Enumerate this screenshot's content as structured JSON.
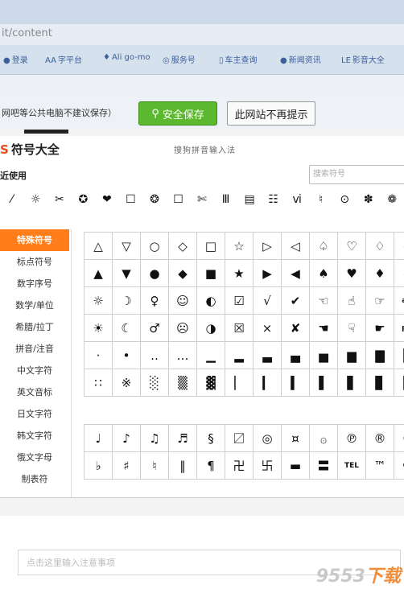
{
  "browser": {
    "address": "it/content",
    "favorites": [
      {
        "icon": "●",
        "label": "登录"
      },
      {
        "icon": "AA",
        "label": "字平台"
      },
      {
        "icon": "♦",
        "label": "Ali go-mo"
      },
      {
        "icon": "◎",
        "label": "服务号"
      },
      {
        "icon": "▯",
        "label": "车主查询"
      },
      {
        "icon": "●",
        "label": "新闻资讯"
      },
      {
        "icon": "LE",
        "label": "影音大全"
      }
    ]
  },
  "save_prompt": {
    "text": "网吧等公共电脑不建议保存）",
    "save_button": "安全保存",
    "no_prompt_button": "此网站不再提示"
  },
  "popup": {
    "title": "符号大全",
    "ime_name": "搜狗拼音输入法",
    "recent_label": "近使用",
    "search_placeholder": "搜索符号",
    "recent_symbols": [
      "⁄",
      "☼",
      "✂",
      "✪",
      "❤",
      "☐",
      "❂",
      "☐",
      "✄",
      "Ⅲ",
      "▤",
      "☷",
      "ⅵ",
      "♮",
      "⊙",
      "✽",
      "❁"
    ],
    "categories": [
      "特殊符号",
      "标点符号",
      "数字序号",
      "数学/单位",
      "希腊/拉丁",
      "拼音/注音",
      "中文字符",
      "英文音标",
      "日文字符",
      "韩文字符",
      "俄文字母",
      "制表符"
    ],
    "active_category": "特殊符号",
    "grid1": [
      [
        "△",
        "▽",
        "○",
        "◇",
        "□",
        "☆",
        "▷",
        "◁",
        "♤",
        "♡",
        "♢",
        "♧"
      ],
      [
        "▲",
        "▼",
        "●",
        "◆",
        "■",
        "★",
        "▶",
        "◀",
        "♠",
        "♥",
        "♦",
        "♣"
      ],
      [
        "☼",
        "☽",
        "♀",
        "☺",
        "◐",
        "☑",
        "√",
        "✔",
        "☜",
        "☝",
        "☞",
        "am"
      ],
      [
        "☀",
        "☾",
        "♂",
        "☹",
        "◑",
        "☒",
        "×",
        "✘",
        "☚",
        "☟",
        "☛",
        "pm"
      ],
      [
        "·",
        "•",
        "‥",
        "…",
        "▁",
        "▂",
        "▃",
        "▄",
        "▅",
        "▆",
        "▇",
        "█"
      ],
      [
        "∷",
        "※",
        "░",
        "▒",
        "▓",
        "▏",
        "▎",
        "▍",
        "▌",
        "▋",
        "▊",
        "▉"
      ]
    ],
    "grid2": [
      [
        "♩",
        "♪",
        "♫",
        "♬",
        "§",
        "〼",
        "◎",
        "¤",
        "۞",
        "℗",
        "®",
        "©"
      ],
      [
        "♭",
        "♯",
        "♮",
        "‖",
        "¶",
        "卍",
        "卐",
        "▬",
        "〓",
        "TEL",
        "™",
        "Co"
      ]
    ]
  },
  "note_placeholder": "点击这里输入注意事项",
  "watermark": {
    "main": "9553",
    "sub": "下载"
  }
}
